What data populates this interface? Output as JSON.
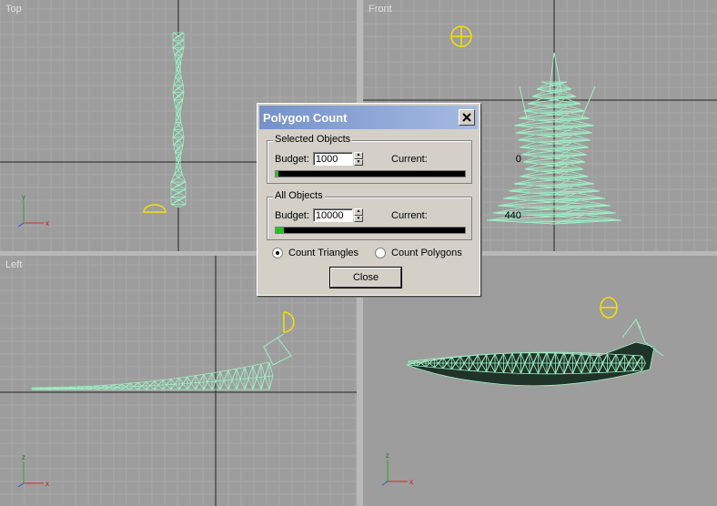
{
  "viewports": {
    "top": {
      "label": "Top"
    },
    "front": {
      "label": "Front"
    },
    "left": {
      "label": "Left"
    },
    "perspective": {
      "label": ""
    }
  },
  "dialog": {
    "title": "Polygon Count",
    "selected": {
      "group_label": "Selected Objects",
      "budget_label": "Budget:",
      "budget_value": "1000",
      "current_label": "Current:",
      "current_value": "0",
      "fill_fraction": 0.01
    },
    "all": {
      "group_label": "All Objects",
      "budget_label": "Budget:",
      "budget_value": "10000",
      "current_label": "Current:",
      "current_value": "440",
      "fill_fraction": 0.044
    },
    "radio_triangles": "Count Triangles",
    "radio_polygons": "Count Polygons",
    "close_label": "Close"
  },
  "colors": {
    "viewport_bg": "#9d9d9d",
    "grid": "#a9a9a9",
    "mesh": "#9ef0c4",
    "active_border": "#f5e000"
  }
}
